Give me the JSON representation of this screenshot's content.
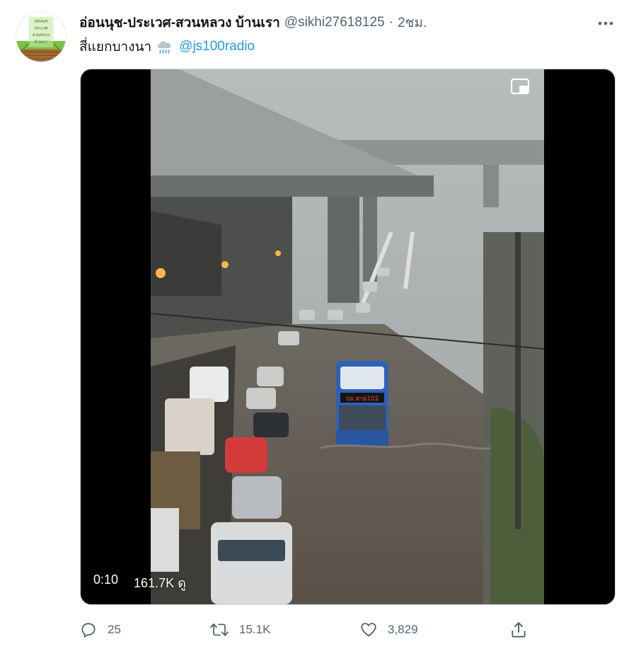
{
  "tweet": {
    "display_name": "อ่อนนุช-ประเวศ-สวนหลวง บ้านเรา",
    "handle": "@sikhi27618125",
    "separator": "·",
    "time": "2ชม.",
    "text": "สี่แยกบางนา",
    "text_icon": "rain-cloud-icon",
    "mention": "@js100radio",
    "avatar_text": [
      "อ่อนนุช",
      "ประเวศ",
      "สวนหลวง",
      "บ้านเรา"
    ]
  },
  "video": {
    "elapsed": "0:10",
    "views": "161.7K ดู",
    "bus_sign": "ปอ.สาย102"
  },
  "actions": {
    "reply_count": "25",
    "retweet_count": "15.1K",
    "like_count": "3,829",
    "reply_icon": "reply-icon",
    "retweet_icon": "retweet-icon",
    "like_icon": "heart-icon",
    "share_icon": "share-icon"
  },
  "colors": {
    "accent": "#1d9bf0",
    "secondary_text": "#536471",
    "primary_text": "#0f1419"
  }
}
